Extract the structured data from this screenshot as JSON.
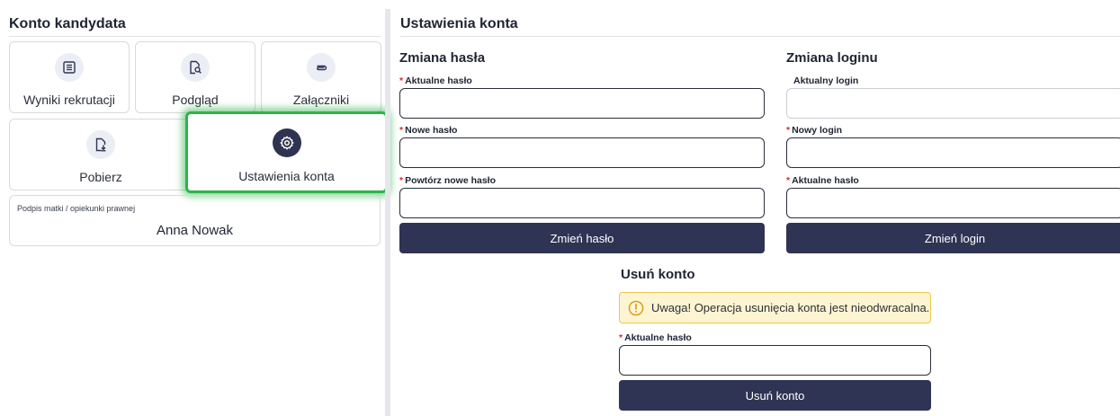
{
  "sidebar": {
    "title": "Konto kandydata",
    "tiles": [
      {
        "label": "Wyniki rekrutacji",
        "icon": "list-icon"
      },
      {
        "label": "Podgląd",
        "icon": "document-search-icon"
      },
      {
        "label": "Załączniki",
        "icon": "paperclip-icon"
      },
      {
        "label": "Pobierz",
        "icon": "file-download-icon"
      },
      {
        "label": "Ustawienia konta",
        "icon": "gear-icon",
        "active": true
      }
    ],
    "signature": {
      "label": "Podpis matki / opiekunki prawnej",
      "value": "Anna Nowak"
    }
  },
  "settings": {
    "title": "Ustawienia konta",
    "password_change": {
      "title": "Zmiana hasła",
      "current_label": "Aktualne hasło",
      "new_label": "Nowe hasło",
      "repeat_label": "Powtórz nowe hasło",
      "button": "Zmień hasło"
    },
    "login_change": {
      "title": "Zmiana loginu",
      "current_login_label": "Aktualny login",
      "new_login_label": "Nowy login",
      "password_label": "Aktualne hasło",
      "button": "Zmień login"
    },
    "delete_account": {
      "title": "Usuń konto",
      "warning": "Uwaga! Operacja usunięcia konta jest nieodwracalna.",
      "password_label": "Aktualne hasło",
      "button": "Usuń konto"
    }
  },
  "colors": {
    "primary": "#2f3454",
    "active_outline": "#2fb34a",
    "required": "#d32f2f",
    "warning_bg": "#fdf5d2",
    "warning_border": "#e8c84d"
  }
}
